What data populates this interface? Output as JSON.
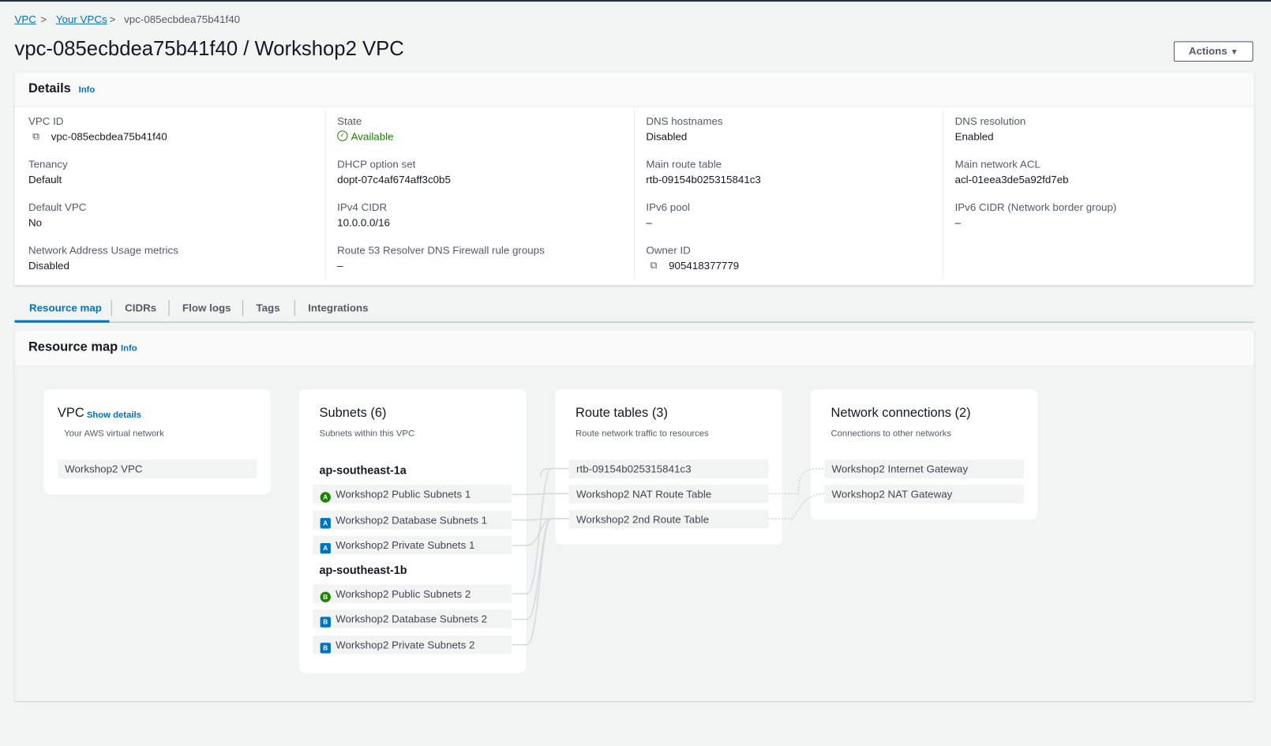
{
  "breadcrumb": [
    "VPC",
    "Your VPCs",
    "vpc-085ecbdea75b41f40"
  ],
  "title": "vpc-085ecbdea75b41f40 / Workshop2 VPC",
  "actions_label": "Actions",
  "details": {
    "title": "Details",
    "info": "Info",
    "fields": [
      {
        "label": "VPC ID",
        "value": "vpc-085ecbdea75b41f40"
      },
      {
        "label": "State",
        "value": "Available"
      },
      {
        "label": "DNS hostnames",
        "value": "Disabled"
      },
      {
        "label": "DNS resolution",
        "value": "Enabled"
      },
      {
        "label": "Tenancy",
        "value": "Default"
      },
      {
        "label": "DHCP option set",
        "value": "dopt-07c4af674aff3c0b5"
      },
      {
        "label": "Main route table",
        "value": "rtb-09154b025315841c3"
      },
      {
        "label": "Main network ACL",
        "value": "acl-01eea3de5a92fd7eb"
      },
      {
        "label": "Default VPC",
        "value": "No"
      },
      {
        "label": "IPv4 CIDR",
        "value": "10.0.0.0/16"
      },
      {
        "label": "IPv6 pool",
        "value": "–"
      },
      {
        "label": "IPv6 CIDR (Network border group)",
        "value": "–"
      },
      {
        "label": "Network Address Usage metrics",
        "value": "Disabled"
      },
      {
        "label": "Route 53 Resolver DNS Firewall rule groups",
        "value": "–"
      },
      {
        "label": "Owner ID",
        "value": "905418377779"
      }
    ]
  },
  "tabs": [
    "Resource map",
    "CIDRs",
    "Flow logs",
    "Tags",
    "Integrations"
  ],
  "resource_map": {
    "title": "Resource map",
    "info": "Info",
    "vpc": {
      "title": "VPC",
      "show_details": "Show details",
      "subtitle": "Your AWS virtual network",
      "item": "Workshop2 VPC"
    },
    "subnets": {
      "title": "Subnets (6)",
      "subtitle": "Subnets within this VPC",
      "az": [
        {
          "name": "ap-southeast-1a",
          "items": [
            {
              "badge": "A",
              "type": "public",
              "name": "Workshop2 Public Subnets 1"
            },
            {
              "badge": "A",
              "type": "private",
              "name": "Workshop2 Database Subnets 1"
            },
            {
              "badge": "A",
              "type": "private",
              "name": "Workshop2 Private Subnets 1"
            }
          ]
        },
        {
          "name": "ap-southeast-1b",
          "items": [
            {
              "badge": "B",
              "type": "public",
              "name": "Workshop2 Public Subnets 2"
            },
            {
              "badge": "B",
              "type": "private",
              "name": "Workshop2 Database Subnets 2"
            },
            {
              "badge": "B",
              "type": "private",
              "name": "Workshop2 Private Subnets 2"
            }
          ]
        }
      ]
    },
    "route_tables": {
      "title": "Route tables (3)",
      "subtitle": "Route network traffic to resources",
      "items": [
        "rtb-09154b025315841c3",
        "Workshop2 NAT Route Table",
        "Workshop2 2nd Route Table"
      ]
    },
    "network": {
      "title": "Network connections (2)",
      "subtitle": "Connections to other networks",
      "items": [
        "Workshop2 Internet Gateway",
        "Workshop2 NAT Gateway"
      ]
    }
  }
}
